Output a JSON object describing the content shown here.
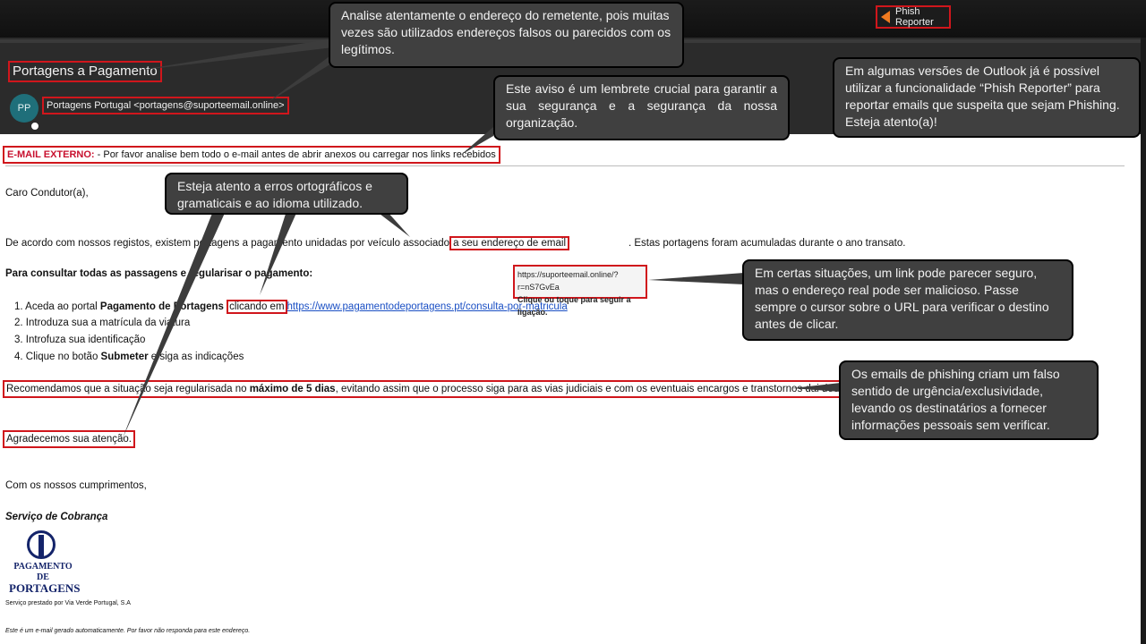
{
  "toolbar": {
    "phish_reporter_label": "Phish Reporter"
  },
  "email": {
    "subject": "Portagens a Pagamento",
    "avatar_initials": "PP",
    "sender": "Portagens Portugal <portagens@suporteemail.online>",
    "external_banner": {
      "tag": "E-MAIL EXTERNO:",
      "text": " - Por favor analise bem todo o e-mail antes de abrir anexos ou carregar nos links recebidos"
    },
    "greeting": "Caro Condutor(a),",
    "para1": {
      "before": "De acordo com nossos registos, existem portagens a pagamento unidadas por veículo associado",
      "boxed": "a seu endereço de email",
      "after": ". Estas portagens foram acumuladas durante o ano transato."
    },
    "consult_heading": "Para consultar todas as passagens e regularisar o pagamento:",
    "steps": {
      "s1_prefix": "1. Aceda ao portal ",
      "s1_bold": "Pagamento de Portagens",
      "s1_boxed": "clicando em",
      "s1_link": "https://www.pagamentodeportagens.pt/consulta-por-matricula",
      "s2": "2. Introduza sua a matrícula da viatura",
      "s3": "3. Introfuza sua identificação",
      "s4_prefix": "4. Clique no botão ",
      "s4_bold": "Submeter",
      "s4_suffix": " e siga as indicações"
    },
    "urgency": {
      "before": "Recomendamos que a situação seja regularisada no ",
      "bold": "máximo de 5 dias",
      "after": ", evitando assim que o processo siga para as vias judiciais e com os eventuais encargos e transtornos dai decorrentes."
    },
    "thanks": "Agradecemos sua atenção.",
    "closing": "Com os nossos cumprimentos,",
    "signature": "Serviço de Cobrança",
    "logo_line1": "PAGAMENTO DE",
    "logo_line2": "PORTAGENS",
    "provider": "Serviço prestado por Via Verde Portugal, S.A",
    "auto_notice": "Este é um e-mail gerado automaticamente. Por favor não responda para este endereço."
  },
  "link_tooltip": {
    "url": "https://suporteemail.online/?r=nS7GvEa",
    "hint": "Clique ou toque para seguir a ligação."
  },
  "callouts": {
    "sender": "Analise atentamente o endereço do remetente, pois muitas vezes são utilizados endereços falsos ou parecidos com os legítimos.",
    "reporter": "Em algumas versões de Outlook já é possível utilizar a funcionalidade “Phish Reporter” para reportar emails que suspeita que sejam Phishing. Esteja atento(a)!",
    "banner": "Este aviso é um lembrete crucial para garantir a sua segurança e a segurança da nossa organização.",
    "grammar": "Esteja atento a erros ortográficos e gramaticais e ao idioma utilizado.",
    "link": "Em certas situações, um link pode parecer seguro, mas o endereço real pode ser malicioso. Passe sempre o cursor sobre o URL para verificar o destino antes de clicar.",
    "urgency": "Os emails de phishing criam um falso sentido de urgência/exclusividade, levando os destinatários a fornecer informações pessoais sem verificar."
  }
}
